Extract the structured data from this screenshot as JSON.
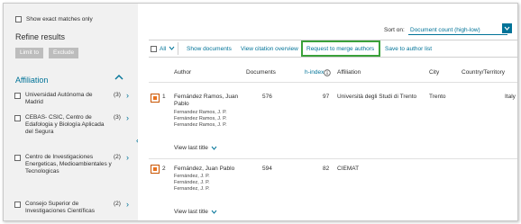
{
  "sidebar": {
    "exact_match_label": "Show exact matches only",
    "refine_title": "Refine results",
    "limit_label": "Limit to",
    "exclude_label": "Exclude",
    "affiliation_title": "Affiliation",
    "affiliations": [
      {
        "name": "Universidad Autónoma de Madrid",
        "count": "(3)"
      },
      {
        "name": "CEBAS- CSIC, Centro de Edafologia y Biología Aplicada del Segura",
        "count": "(3)"
      },
      {
        "name": "Centro de Investigaciones Energeticas, Medioambientales y Tecnologicas",
        "count": "(2)"
      },
      {
        "name": "Consejo Superior de Investigaciones Científicas",
        "count": "(2)"
      }
    ]
  },
  "toolbar": {
    "sort_label": "Sort on:",
    "sort_value": "Document count (high-low)",
    "all_label": "All",
    "show_documents": "Show documents",
    "view_citation_overview": "View citation overview",
    "request_merge": "Request to merge authors",
    "save_to_list": "Save to author list"
  },
  "table": {
    "headers": {
      "author": "Author",
      "documents": "Documents",
      "hindex": "h-index",
      "affiliation": "Affiliation",
      "city": "City",
      "country": "Country/Territory"
    },
    "rows": [
      {
        "num": "1",
        "author": "Fernández Ramos, Juan Pablo",
        "aliases": [
          "Fernandez Ramos, J. P.",
          "Fernández Ramos, J. P.",
          "Fernandez Ramos, J. P."
        ],
        "documents": "576",
        "hindex": "97",
        "affiliation": "Università degli Studi di Trento",
        "city": "Trento",
        "country": "Italy",
        "view_last_title": "View last title"
      },
      {
        "num": "2",
        "author": "Fernández, Juan Pablo",
        "aliases": [
          "Fernández, J. P.",
          "Fernández, J. P.",
          "Fernandez, J. P."
        ],
        "documents": "594",
        "hindex": "82",
        "affiliation": "CIEMAT",
        "city": "",
        "country": "",
        "view_last_title": "View last title"
      }
    ]
  },
  "colors": {
    "accent": "#007398",
    "highlight_border": "#3aa13a",
    "selected_checkbox": "#e9711c",
    "sidebar_bg": "#f1f1f1"
  }
}
